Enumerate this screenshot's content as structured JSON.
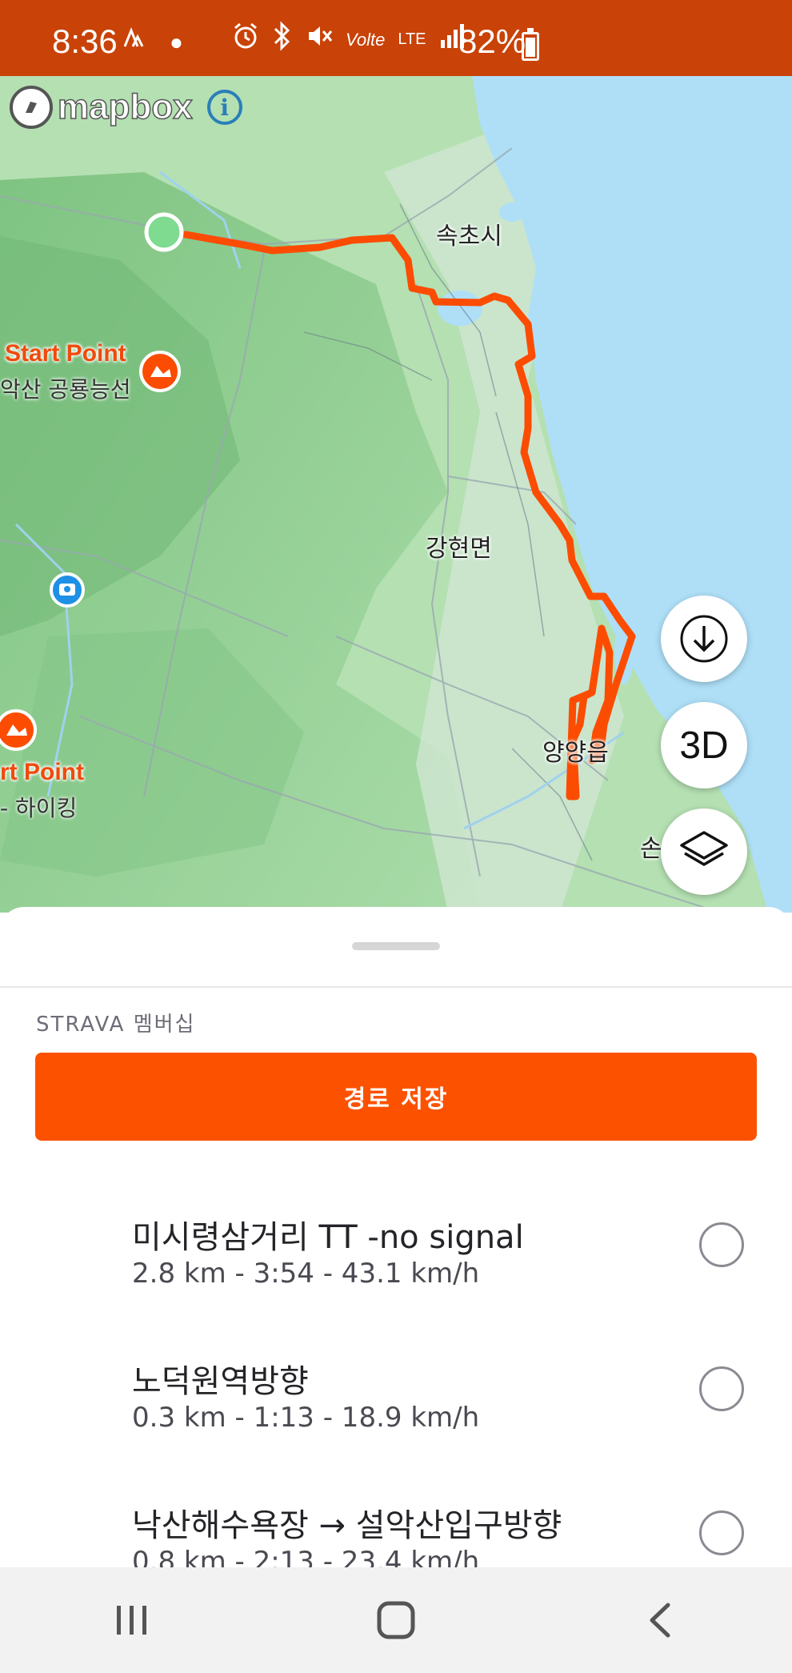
{
  "status_bar": {
    "time": "8:36",
    "battery": "82%",
    "icons": [
      "strava-icon",
      "dot-icon",
      "alarm-icon",
      "bluetooth-icon",
      "mute-icon",
      "volte-icon",
      "lte-icon",
      "signal-icon",
      "battery-icon"
    ],
    "volte_text": "Volte",
    "lte_text": "LTE",
    "color": "#c94207"
  },
  "map": {
    "provider_logo": "mapbox",
    "info_icon": "i",
    "places": [
      {
        "name": "속초시"
      },
      {
        "name": "강현면"
      },
      {
        "name": "양양읍"
      },
      {
        "name": "손"
      }
    ],
    "pois": [
      {
        "title": "Start Point",
        "subtitle": "악산 공룡능선"
      },
      {
        "title": "rt Point",
        "subtitle": "- 하이킹"
      }
    ],
    "route_color": "#fc4c02",
    "start_marker_color": "#7edb8f",
    "buttons": {
      "download_icon": "download-icon",
      "threed_label": "3D",
      "layers_icon": "layers-icon"
    }
  },
  "sheet": {
    "membership_label": "STRAVA 멤버십",
    "save_button_label": "경로 저장",
    "accent_color": "#fc5200",
    "segments": [
      {
        "name": "미시령삼거리 TT -no signal",
        "stats": "2.8 km - 3:54 - 43.1 km/h"
      },
      {
        "name": "노덕원역방향",
        "stats": "0.3 km - 1:13 - 18.9 km/h"
      },
      {
        "name": "낙산해수욕장 → 설악산입구방향",
        "stats": "0.8 km - 2:13 - 23.4 km/h"
      }
    ]
  },
  "nav_bar": {
    "icons": [
      "recent-apps-icon",
      "home-icon",
      "back-icon"
    ]
  }
}
